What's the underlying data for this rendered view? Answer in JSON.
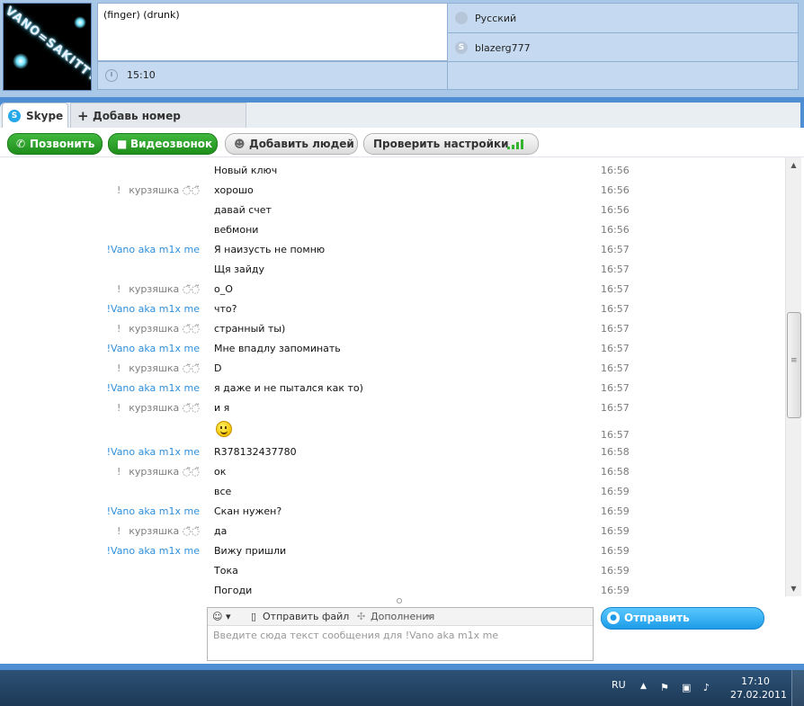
{
  "profile": {
    "avatar_text": "VANO=SAKITTY",
    "mood": "(finger)    (drunk)",
    "local_time": "15:10",
    "language": "Русский",
    "skype_name": "blazerg777"
  },
  "tabs": [
    {
      "label": "Skype"
    },
    {
      "label": "Добавь номер телефона"
    }
  ],
  "toolbar": {
    "call_label": "Позвонить",
    "video_label": "Видеозвонок",
    "add_people_label": "Добавить людей",
    "check_settings_label": "Проверить настройки"
  },
  "messages": [
    {
      "mark": "",
      "sender": "",
      "text": "Новый ключ",
      "time": "16:56"
    },
    {
      "mark": "!",
      "sender": "курзяшка ◌̃◌̃",
      "text": "хорошо",
      "time": "16:56"
    },
    {
      "mark": "",
      "sender": "",
      "text": "давай счет",
      "time": "16:56"
    },
    {
      "mark": "",
      "sender": "",
      "text": "вебмони",
      "time": "16:56"
    },
    {
      "mark": "",
      "sender": "!Vano aka m1x me",
      "text": "Я наизусть не помню",
      "time": "16:57"
    },
    {
      "mark": "",
      "sender": "",
      "text": "Щя зайду",
      "time": "16:57"
    },
    {
      "mark": "!",
      "sender": "курзяшка ◌̃◌̃",
      "text": "о_О",
      "time": "16:57"
    },
    {
      "mark": "",
      "sender": "!Vano aka m1x me",
      "text": "что?",
      "time": "16:57"
    },
    {
      "mark": "!",
      "sender": "курзяшка ◌̃◌̃",
      "text": "странный ты)",
      "time": "16:57"
    },
    {
      "mark": "",
      "sender": "!Vano aka m1x me",
      "text": "Мне впадлу запоминать",
      "time": "16:57"
    },
    {
      "mark": "!",
      "sender": "курзяшка ◌̃◌̃",
      "text": "D",
      "time": "16:57"
    },
    {
      "mark": "",
      "sender": "!Vano aka m1x me",
      "text": "я даже и не пытался как то)",
      "time": "16:57"
    },
    {
      "mark": "!",
      "sender": "курзяшка ◌̃◌̃",
      "text": "и я",
      "time": "16:57"
    },
    {
      "mark": "",
      "sender": "",
      "text": "",
      "emoticon": "smile-icon",
      "time": "16:57"
    },
    {
      "mark": "",
      "sender": "!Vano aka m1x me",
      "text": "R378132437780",
      "time": "16:58"
    },
    {
      "mark": "!",
      "sender": "курзяшка ◌̃◌̃",
      "text": "ок",
      "time": "16:58"
    },
    {
      "mark": "",
      "sender": "",
      "text": "все",
      "time": "16:59"
    },
    {
      "mark": "",
      "sender": "!Vano aka m1x me",
      "text": "Скан нужен?",
      "time": "16:59"
    },
    {
      "mark": "!",
      "sender": "курзяшка ◌̃◌̃",
      "text": "да",
      "time": "16:59"
    },
    {
      "mark": "",
      "sender": "!Vano aka m1x me",
      "text": "Вижу пришли",
      "time": "16:59"
    },
    {
      "mark": "",
      "sender": "",
      "text": "Тока",
      "time": "16:59"
    },
    {
      "mark": "",
      "sender": "",
      "text": "Погоди",
      "time": "16:59"
    }
  ],
  "composer": {
    "emoticons_label": "☺ ▾",
    "send_file_label": "Отправить файл",
    "extras_label": "Дополнения",
    "placeholder": "Введите сюда текст сообщения для !Vano aka m1x me",
    "send_label": "Отправить сообщение"
  },
  "taskbar": {
    "lang": "RU",
    "time": "17:10",
    "date": "27.02.2011"
  },
  "colors": {
    "frame": "#4f8ed2",
    "skype_blue": "#25a8ea",
    "call_green": "#2aa627",
    "sender_blue": "#2e8fdc"
  }
}
